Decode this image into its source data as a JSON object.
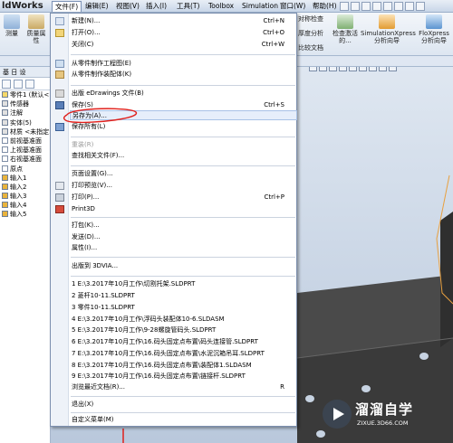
{
  "app": {
    "title": "ldWorks"
  },
  "menubar": {
    "items": [
      "文件(F)",
      "编辑(E)",
      "视图(V)",
      "插入(I)",
      "工具(T)",
      "Toolbox",
      "Simulation",
      "窗口(W)",
      "帮助(H)"
    ]
  },
  "ribbon": {
    "buttons": [
      "测量",
      "质量属性",
      "对称检查",
      "厚度分析",
      "比较文档",
      "检查激活的...",
      "SimulationXpress分析向导",
      "FloXpress分析向导"
    ]
  },
  "tree": {
    "tabs_label": "基 日 设",
    "items": [
      "零件1 (默认<<默",
      "传感器",
      "注解",
      "实体(5)",
      "材质 <未指定>",
      "前视基准面",
      "上视基准面",
      "右视基准面",
      "原点",
      "输入1",
      "输入2",
      "输入3",
      "输入4",
      "输入5"
    ]
  },
  "file_menu": {
    "items": [
      {
        "label": "新建(N)...",
        "shortcut": "Ctrl+N"
      },
      {
        "label": "打开(O)...",
        "shortcut": "Ctrl+O"
      },
      {
        "label": "关闭(C)",
        "shortcut": "Ctrl+W"
      },
      {
        "label": "从零件制作工程图(E)",
        "shortcut": ""
      },
      {
        "label": "从零件制作装配体(K)",
        "shortcut": ""
      },
      {
        "label": "出版 eDrawings 文件(B)",
        "shortcut": ""
      },
      {
        "label": "保存(S)",
        "shortcut": "Ctrl+S"
      },
      {
        "label": "另存为(A)...",
        "shortcut": ""
      },
      {
        "label": "保存所有(L)",
        "shortcut": ""
      },
      {
        "label": "重装(R)",
        "shortcut": ""
      },
      {
        "label": "查找相关文件(F)...",
        "shortcut": ""
      },
      {
        "label": "页面设置(G)...",
        "shortcut": ""
      },
      {
        "label": "打印预览(V)...",
        "shortcut": ""
      },
      {
        "label": "打印(P)...",
        "shortcut": "Ctrl+P"
      },
      {
        "label": "Print3D",
        "shortcut": ""
      },
      {
        "label": "打包(K)...",
        "shortcut": ""
      },
      {
        "label": "发送(D)...",
        "shortcut": ""
      },
      {
        "label": "属性(I)...",
        "shortcut": ""
      },
      {
        "label": "出版到 3DVIA...",
        "shortcut": ""
      },
      {
        "label": "1 E:\\3.2017年10月工作\\切割托架.SLDPRT",
        "shortcut": ""
      },
      {
        "label": "2 菱杆10-11.SLDPRT",
        "shortcut": ""
      },
      {
        "label": "3 零件10-11.SLDPRT",
        "shortcut": ""
      },
      {
        "label": "4 E:\\3.2017年10月工作\\浮码头装配体10-6.SLDASM",
        "shortcut": ""
      },
      {
        "label": "5 E:\\3.2017年10月工作\\9-28螺旋管码头.SLDPRT",
        "shortcut": ""
      },
      {
        "label": "6 E:\\3.2017年10月工作\\16.码头固定点布置\\码头连接管.SLDPRT",
        "shortcut": ""
      },
      {
        "label": "7 E:\\3.2017年10月工作\\16.码头固定点布置\\水泥沉箱吊耳.SLDPRT",
        "shortcut": ""
      },
      {
        "label": "8 E:\\3.2017年10月工作\\16.码头固定点布置\\装配体1.SLDASM",
        "shortcut": ""
      },
      {
        "label": "9 E:\\3.2017年10月工作\\16.码头固定点布置\\链接杆.SLDPRT",
        "shortcut": ""
      },
      {
        "label": "浏览最近文档(R)...",
        "shortcut": "R"
      },
      {
        "label": "退出(X)",
        "shortcut": ""
      },
      {
        "label": "自定义菜单(M)",
        "shortcut": ""
      }
    ]
  },
  "watermark": {
    "title": "溜溜自学",
    "sub": "ZIXUE.3D66.COM"
  },
  "colors": {
    "highlight": "#e6eefb",
    "annotation_circle": "#e0201c",
    "model": "#3b3b3b"
  }
}
